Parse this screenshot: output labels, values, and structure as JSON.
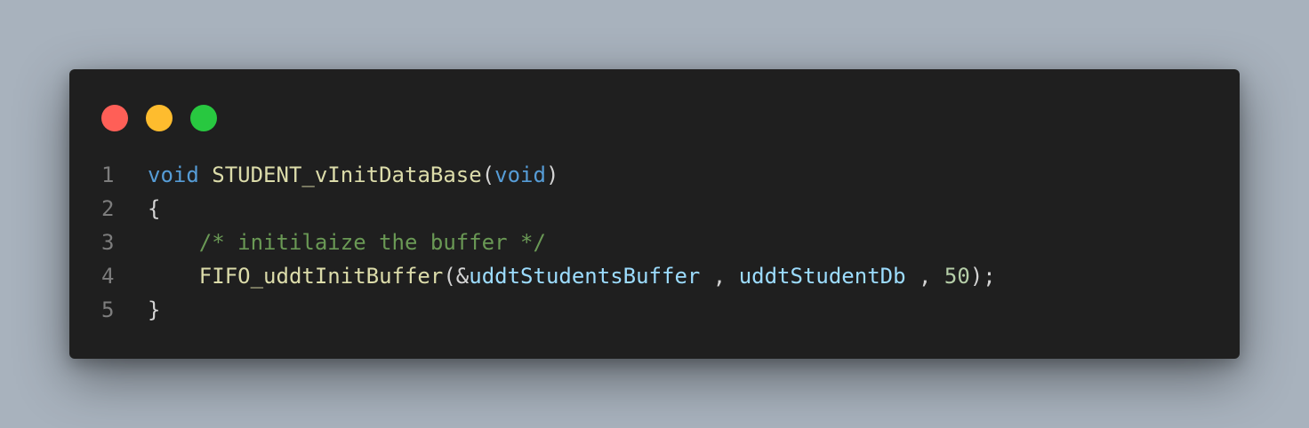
{
  "window": {
    "controls": [
      {
        "name": "close",
        "color": "#ff5f57"
      },
      {
        "name": "minimize",
        "color": "#febc2e"
      },
      {
        "name": "maximize",
        "color": "#28c840"
      }
    ]
  },
  "colors": {
    "keyword": "#569cd6",
    "function": "#dcdcaa",
    "variable": "#9cdcfe",
    "number": "#b5cea8",
    "comment": "#6a9955",
    "default": "#d4d4d4",
    "line_number": "#7d7d7d",
    "background": "#1f1f1f"
  },
  "code": {
    "lines": [
      {
        "number": "1",
        "tokens": [
          {
            "text": "void",
            "kind": "keyword"
          },
          {
            "text": " ",
            "kind": "default"
          },
          {
            "text": "STUDENT_vInitDataBase",
            "kind": "function"
          },
          {
            "text": "(",
            "kind": "default"
          },
          {
            "text": "void",
            "kind": "keyword"
          },
          {
            "text": ")",
            "kind": "default"
          }
        ]
      },
      {
        "number": "2",
        "tokens": [
          {
            "text": "{",
            "kind": "default"
          }
        ]
      },
      {
        "number": "3",
        "tokens": [
          {
            "text": "    ",
            "kind": "default"
          },
          {
            "text": "/* initilaize the buffer */",
            "kind": "comment"
          }
        ]
      },
      {
        "number": "4",
        "tokens": [
          {
            "text": "    ",
            "kind": "default"
          },
          {
            "text": "FIFO_uddtInitBuffer",
            "kind": "function"
          },
          {
            "text": "(&",
            "kind": "default"
          },
          {
            "text": "uddtStudentsBuffer",
            "kind": "variable"
          },
          {
            "text": " , ",
            "kind": "default"
          },
          {
            "text": "uddtStudentDb",
            "kind": "variable"
          },
          {
            "text": " , ",
            "kind": "default"
          },
          {
            "text": "50",
            "kind": "number"
          },
          {
            "text": ");",
            "kind": "default"
          }
        ]
      },
      {
        "number": "5",
        "tokens": [
          {
            "text": "}",
            "kind": "default"
          }
        ]
      }
    ]
  }
}
